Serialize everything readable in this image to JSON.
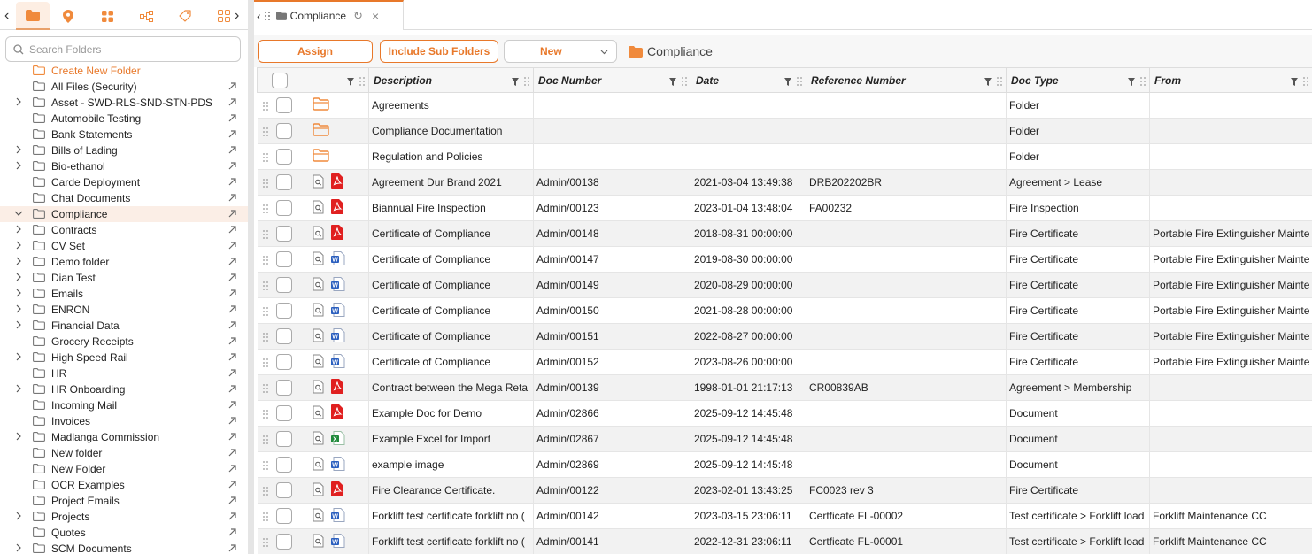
{
  "sidebar": {
    "search_placeholder": "Search Folders",
    "create_label": "Create New Folder",
    "tabs": [
      "folder-icon",
      "pin-icon",
      "apps-icon",
      "workflow-icon",
      "tag-icon",
      "grid-icon"
    ],
    "items": [
      {
        "label": "All Files (Security)",
        "expandable": false
      },
      {
        "label": "Asset - SWD-RLS-SND-STN-PDS",
        "expandable": true
      },
      {
        "label": "Automobile Testing",
        "expandable": false
      },
      {
        "label": "Bank Statements",
        "expandable": false
      },
      {
        "label": "Bills of Lading",
        "expandable": true
      },
      {
        "label": "Bio-ethanol",
        "expandable": true
      },
      {
        "label": "Carde Deployment",
        "expandable": false
      },
      {
        "label": "Chat Documents",
        "expandable": false
      },
      {
        "label": "Compliance",
        "expandable": true,
        "expanded": true,
        "selected": true
      },
      {
        "label": "Contracts",
        "expandable": true
      },
      {
        "label": "CV Set",
        "expandable": true
      },
      {
        "label": "Demo folder",
        "expandable": true
      },
      {
        "label": "Dian Test",
        "expandable": true
      },
      {
        "label": "Emails",
        "expandable": true
      },
      {
        "label": "ENRON",
        "expandable": true
      },
      {
        "label": "Financial Data",
        "expandable": true
      },
      {
        "label": "Grocery Receipts",
        "expandable": false
      },
      {
        "label": "High Speed Rail",
        "expandable": true
      },
      {
        "label": "HR",
        "expandable": false
      },
      {
        "label": "HR Onboarding",
        "expandable": true
      },
      {
        "label": "Incoming Mail",
        "expandable": false
      },
      {
        "label": "Invoices",
        "expandable": false
      },
      {
        "label": "Madlanga Commission",
        "expandable": true
      },
      {
        "label": "New folder",
        "expandable": false
      },
      {
        "label": "New Folder",
        "expandable": false
      },
      {
        "label": "OCR Examples",
        "expandable": false
      },
      {
        "label": "Project Emails",
        "expandable": false
      },
      {
        "label": "Projects",
        "expandable": true
      },
      {
        "label": "Quotes",
        "expandable": false
      },
      {
        "label": "SCM Documents",
        "expandable": true
      }
    ]
  },
  "tab": {
    "title": "Compliance"
  },
  "toolbar": {
    "assign_label": "Assign",
    "include_sub_label": "Include Sub Folders",
    "new_label": "New",
    "breadcrumb": "Compliance"
  },
  "grid": {
    "columns": [
      "Description",
      "Doc Number",
      "Date",
      "Reference Number",
      "Doc Type",
      "From"
    ],
    "rows": [
      {
        "kind": "folder",
        "description": "Agreements",
        "doc_number": "",
        "date": "",
        "reference": "",
        "doc_type": "Folder",
        "from": ""
      },
      {
        "kind": "folder",
        "description": "Compliance Documentation",
        "doc_number": "",
        "date": "",
        "reference": "",
        "doc_type": "Folder",
        "from": ""
      },
      {
        "kind": "folder",
        "description": "Regulation and Policies",
        "doc_number": "",
        "date": "",
        "reference": "",
        "doc_type": "Folder",
        "from": ""
      },
      {
        "kind": "pdf",
        "description": "Agreement Dur Brand 2021",
        "doc_number": "Admin/00138",
        "date": "2021-03-04 13:49:38",
        "reference": "DRB202202BR",
        "doc_type": "Agreement > Lease",
        "from": ""
      },
      {
        "kind": "pdf",
        "description": "Biannual Fire Inspection",
        "doc_number": "Admin/00123",
        "date": "2023-01-04 13:48:04",
        "reference": "FA00232",
        "doc_type": "Fire Inspection",
        "from": ""
      },
      {
        "kind": "pdf",
        "description": "Certificate of Compliance",
        "doc_number": "Admin/00148",
        "date": "2018-08-31 00:00:00",
        "reference": "",
        "doc_type": "Fire Certificate",
        "from": "Portable Fire Extinguisher Mainte"
      },
      {
        "kind": "word",
        "description": "Certificate of Compliance",
        "doc_number": "Admin/00147",
        "date": "2019-08-30 00:00:00",
        "reference": "",
        "doc_type": "Fire Certificate",
        "from": "Portable Fire Extinguisher Mainte"
      },
      {
        "kind": "word",
        "description": "Certificate of Compliance",
        "doc_number": "Admin/00149",
        "date": "2020-08-29 00:00:00",
        "reference": "",
        "doc_type": "Fire Certificate",
        "from": "Portable Fire Extinguisher Mainte"
      },
      {
        "kind": "word",
        "description": "Certificate of Compliance",
        "doc_number": "Admin/00150",
        "date": "2021-08-28 00:00:00",
        "reference": "",
        "doc_type": "Fire Certificate",
        "from": "Portable Fire Extinguisher Mainte"
      },
      {
        "kind": "word",
        "description": "Certificate of Compliance",
        "doc_number": "Admin/00151",
        "date": "2022-08-27 00:00:00",
        "reference": "",
        "doc_type": "Fire Certificate",
        "from": "Portable Fire Extinguisher Mainte"
      },
      {
        "kind": "word",
        "description": "Certificate of Compliance",
        "doc_number": "Admin/00152",
        "date": "2023-08-26 00:00:00",
        "reference": "",
        "doc_type": "Fire Certificate",
        "from": "Portable Fire Extinguisher Mainte"
      },
      {
        "kind": "pdf",
        "description": "Contract between the Mega Reta",
        "doc_number": "Admin/00139",
        "date": "1998-01-01 21:17:13",
        "reference": "CR00839AB",
        "doc_type": "Agreement > Membership",
        "from": ""
      },
      {
        "kind": "pdf",
        "description": "Example Doc for Demo",
        "doc_number": "Admin/02866",
        "date": "2025-09-12 14:45:48",
        "reference": "",
        "doc_type": "Document",
        "from": ""
      },
      {
        "kind": "excel",
        "description": "Example Excel for Import",
        "doc_number": "Admin/02867",
        "date": "2025-09-12 14:45:48",
        "reference": "",
        "doc_type": "Document",
        "from": ""
      },
      {
        "kind": "word",
        "description": "example image",
        "doc_number": "Admin/02869",
        "date": "2025-09-12 14:45:48",
        "reference": "",
        "doc_type": "Document",
        "from": ""
      },
      {
        "kind": "pdf",
        "description": "Fire Clearance Certificate.",
        "doc_number": "Admin/00122",
        "date": "2023-02-01 13:43:25",
        "reference": "FC0023 rev 3",
        "doc_type": "Fire Certificate",
        "from": ""
      },
      {
        "kind": "word",
        "description": "Forklift test certificate forklift no (",
        "doc_number": "Admin/00142",
        "date": "2023-03-15 23:06:11",
        "reference": "Certficate FL-00002",
        "doc_type": "Test certificate > Forklift load",
        "from": "Forklift Maintenance CC"
      },
      {
        "kind": "word",
        "description": "Forklift test certificate forklift no (",
        "doc_number": "Admin/00141",
        "date": "2022-12-31 23:06:11",
        "reference": "Certficate FL-00001",
        "doc_type": "Test certificate > Forklift load",
        "from": "Forklift Maintenance CC"
      }
    ]
  },
  "colors": {
    "accent": "#e8782a",
    "pdf": "#e02020",
    "word": "#2b5fbf",
    "excel": "#1f8a3a",
    "folder": "#f08a3c"
  }
}
